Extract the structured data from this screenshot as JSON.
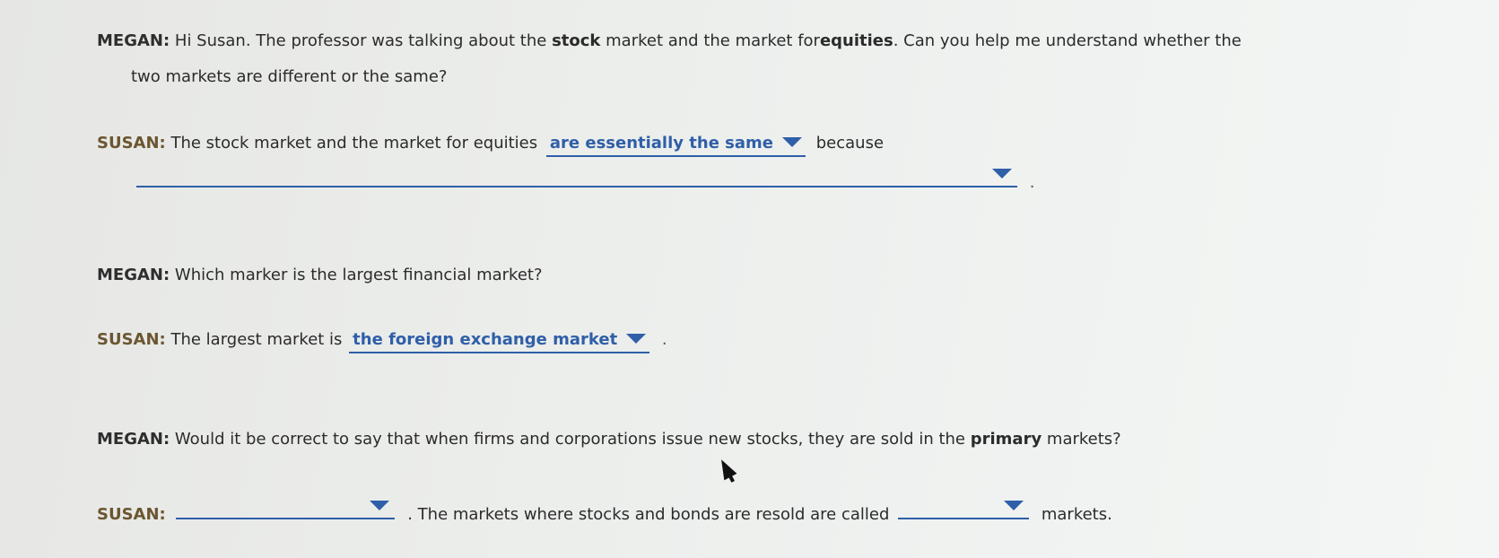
{
  "q1": {
    "megan_speaker": "MEGAN:",
    "megan_t1": "Hi Susan. The professor was talking about the",
    "megan_b1": "stock",
    "megan_t2": "market and the market for",
    "megan_b2": "equities",
    "megan_t3": ". Can you help me understand whether the",
    "megan_line2": "two markets are different or the same?",
    "susan_speaker": "SUSAN:",
    "susan_t1": "The stock market and the market for equities",
    "dropdown1_value": "are essentially the same",
    "susan_t2": "because",
    "dropdown2_value": "",
    "end_punct": "."
  },
  "q2": {
    "megan_speaker": "MEGAN:",
    "megan_text": "Which marker is the largest financial market?",
    "susan_speaker": "SUSAN:",
    "susan_text": "The largest market is",
    "dropdown_value": "the foreign exchange market",
    "end_punct": "."
  },
  "q3": {
    "megan_speaker": "MEGAN:",
    "megan_t1": "Would it be correct to say that when firms and corporations issue new stocks, they are sold in the",
    "megan_b1": "primary",
    "megan_t2": "markets?",
    "susan_speaker": "SUSAN:",
    "dropdown1_value": "",
    "susan_t1": ". The markets where stocks and bonds are resold are called",
    "dropdown2_value": "",
    "susan_t2": "markets."
  },
  "icons": {
    "dropdown_caret": "caret-down-icon",
    "mouse_cursor": "mouse-pointer-icon"
  },
  "colors": {
    "accent": "#2f5fa8",
    "susan_label": "#6b5630"
  }
}
